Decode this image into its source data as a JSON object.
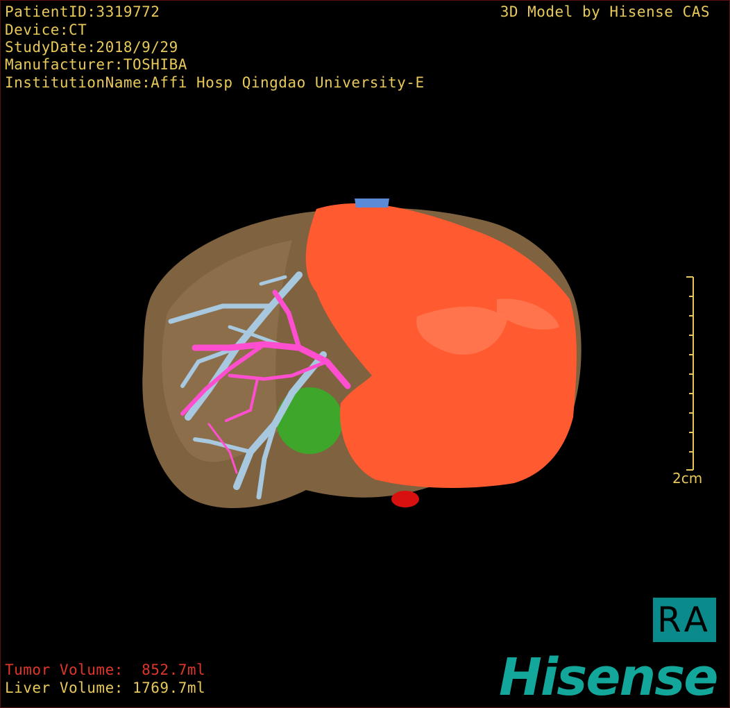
{
  "header": {
    "patient_id": "PatientID:3319772",
    "device": "Device:CT",
    "study_date": "StudyDate:2018/9/29",
    "manufacturer": "Manufacturer:TOSHIBA",
    "institution": "InstitutionName:Affi Hosp Qingdao University-E",
    "credit": "3D Model by Hisense CAS"
  },
  "measurements": {
    "tumor_volume": "Tumor Volume:  852.7ml",
    "liver_volume": "Liver Volume: 1769.7ml"
  },
  "scale": {
    "label": "2cm"
  },
  "orientation": {
    "label": "RA",
    "color": "#0a8a8a"
  },
  "brand": {
    "logo_text": "Hisense",
    "color": "#12a79a"
  },
  "colors": {
    "info_text": "#e8c95a",
    "tumor_text": "#e0362a",
    "liver": "#8a6a45",
    "tumor": "#ff5a30",
    "portal_vein": "#a8c8e0",
    "hepatic_artery": "#ff4fd0",
    "gallbladder": "#3aaa2a",
    "ivc": "#d81010"
  }
}
